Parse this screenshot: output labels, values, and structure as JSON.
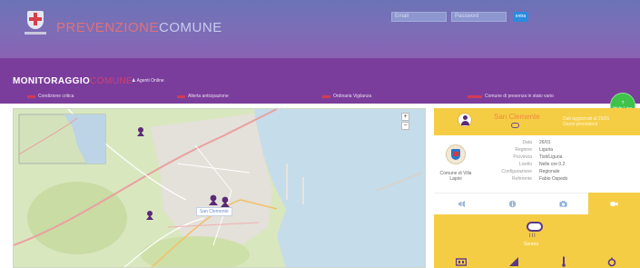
{
  "header": {
    "brand_part1": "PREVENZIONE",
    "brand_part2": "COMUNE",
    "search_placeholder_1": "Email",
    "search_placeholder_2": "Password",
    "login_label": "entra"
  },
  "monitor": {
    "title_main": "MONITORAGGIO",
    "title_accent": "COMUNE",
    "agenti_label": "Agenti Online",
    "legend": [
      {
        "label": "Condizione critica"
      },
      {
        "label": "Allerta anticipazione"
      },
      {
        "label": "Ordinaria Vigilanza"
      },
      {
        "label": "Comune di presenza in stato vario"
      }
    ],
    "fab_line1": "?",
    "fab_line2": "Help Line"
  },
  "map": {
    "tooltip": "San Clemente",
    "zoom_in": "+",
    "zoom_out": "−"
  },
  "panel": {
    "city_name": "San Clemente",
    "note": "Dati aggiornati al 26/01 Giorni precedenti",
    "crest_caption": "Comune di Villa Lapini",
    "info": [
      {
        "k": "Data",
        "v": "26/01"
      },
      {
        "k": "Regione",
        "v": "Liguria"
      },
      {
        "k": "Provincia",
        "v": "Tisti/Liguria"
      },
      {
        "k": "Livello",
        "v": "Nelle ore 0.2"
      },
      {
        "k": "Configurazione",
        "v": "Regionale"
      },
      {
        "k": "Referente",
        "v": "Fabio Ospedo"
      }
    ],
    "weather_label": "Sereno"
  },
  "colors": {
    "header_top": "#6b72b6",
    "band": "#7b3d9c",
    "panel_yellow": "#f5cd45",
    "accent_red": "#d23c54",
    "fab_green": "#3ec24a"
  }
}
